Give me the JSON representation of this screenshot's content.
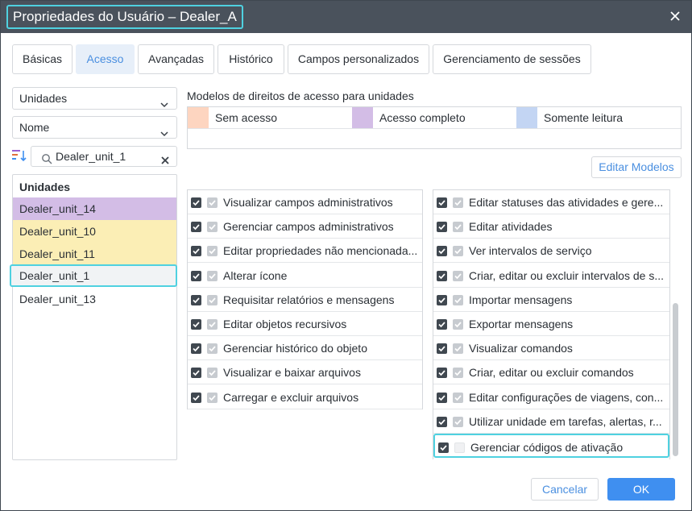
{
  "window": {
    "title": "Propriedades do Usuário – Dealer_A"
  },
  "tabs": [
    {
      "label": "Básicas",
      "active": false
    },
    {
      "label": "Acesso",
      "active": true
    },
    {
      "label": "Avançadas",
      "active": false
    },
    {
      "label": "Histórico",
      "active": false
    },
    {
      "label": "Campos personalizados",
      "active": false
    },
    {
      "label": "Gerenciamento de sessões",
      "active": false
    }
  ],
  "filters": {
    "type_select": "Unidades",
    "sort_select": "Nome",
    "search_value": "Dealer_unit_1"
  },
  "units": {
    "header": "Unidades",
    "items": [
      {
        "name": "Dealer_unit_14",
        "color": "#d3bde6"
      },
      {
        "name": "Dealer_unit_10",
        "color": "#fbeeb5"
      },
      {
        "name": "Dealer_unit_11",
        "color": "#fbeeb5"
      },
      {
        "name": "Dealer_unit_1",
        "color": "#f1f3f5",
        "selected": true
      },
      {
        "name": "Dealer_unit_13",
        "color": "#ffffff"
      }
    ]
  },
  "templates": {
    "heading": "Modelos de direitos de acesso para unidades",
    "legend": [
      {
        "label": "Sem acesso",
        "color": "#fdd5c0"
      },
      {
        "label": "Acesso completo",
        "color": "#d3bde6"
      },
      {
        "label": "Somente leitura",
        "color": "#c3d5f3"
      }
    ],
    "edit_button": "Editar Modelos"
  },
  "rights_left": [
    "Visualizar campos administrativos",
    "Gerenciar campos administrativos",
    "Editar propriedades não mencionada...",
    "Alterar ícone",
    "Requisitar relatórios e mensagens",
    "Editar objetos recursivos",
    "Gerenciar histórico do objeto",
    "Visualizar e baixar arquivos",
    "Carregar e excluir arquivos"
  ],
  "rights_right": [
    {
      "label": "Editar statuses das atividades e gere...",
      "inherited": true
    },
    {
      "label": "Editar atividades",
      "inherited": true
    },
    {
      "label": "Ver intervalos de serviço",
      "inherited": true
    },
    {
      "label": "Criar, editar ou excluir intervalos de s...",
      "inherited": true
    },
    {
      "label": "Importar mensagens",
      "inherited": true
    },
    {
      "label": "Exportar mensagens",
      "inherited": true
    },
    {
      "label": "Visualizar comandos",
      "inherited": true
    },
    {
      "label": "Criar, editar ou excluir comandos",
      "inherited": true
    },
    {
      "label": "Editar configurações de viagens, con...",
      "inherited": true
    },
    {
      "label": "Utilizar unidade em tarefas, alertas, r...",
      "inherited": true
    },
    {
      "label": "Gerenciar códigos de ativação",
      "inherited": false,
      "highlighted": true
    }
  ],
  "footer": {
    "cancel": "Cancelar",
    "ok": "OK"
  }
}
